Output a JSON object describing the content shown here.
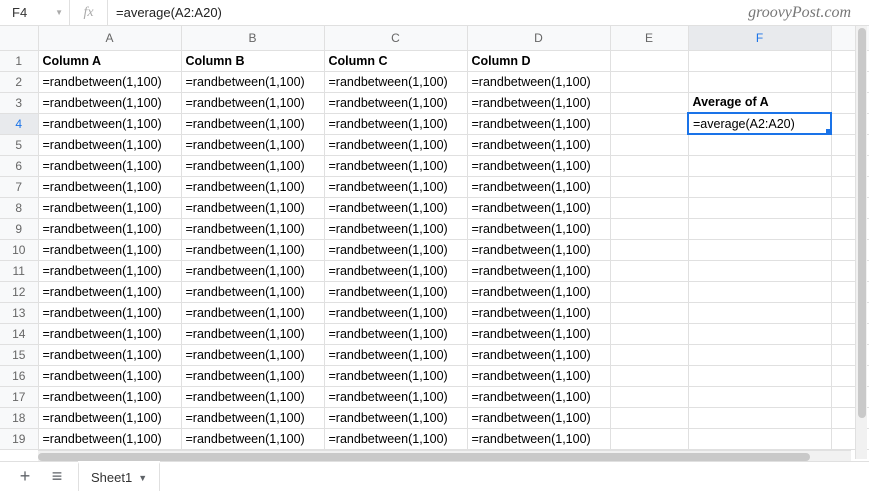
{
  "watermark": "groovyPost.com",
  "namebox": "F4",
  "fx_label": "fx",
  "formula": "=average(A2:A20)",
  "columns": [
    "A",
    "B",
    "C",
    "D",
    "E",
    "F"
  ],
  "active_col": "F",
  "active_row": 4,
  "selected_cell": "F4",
  "tab": {
    "plus": "+",
    "menu": "≡",
    "name": "Sheet1",
    "dd": "▼"
  },
  "rows": [
    {
      "n": 1,
      "cells": {
        "A": "Column A",
        "B": "Column B",
        "C": "Column C",
        "D": "Column D",
        "E": "",
        "F": ""
      },
      "bold": [
        "A",
        "B",
        "C",
        "D"
      ]
    },
    {
      "n": 2,
      "cells": {
        "A": "=randbetween(1,100)",
        "B": "=randbetween(1,100)",
        "C": "=randbetween(1,100)",
        "D": "=randbetween(1,100)",
        "E": "",
        "F": ""
      }
    },
    {
      "n": 3,
      "cells": {
        "A": "=randbetween(1,100)",
        "B": "=randbetween(1,100)",
        "C": "=randbetween(1,100)",
        "D": "=randbetween(1,100)",
        "E": "",
        "F": "Average of A"
      },
      "bold": [
        "F"
      ]
    },
    {
      "n": 4,
      "cells": {
        "A": "=randbetween(1,100)",
        "B": "=randbetween(1,100)",
        "C": "=randbetween(1,100)",
        "D": "=randbetween(1,100)",
        "E": "",
        "F": "=average(A2:A20)"
      }
    },
    {
      "n": 5,
      "cells": {
        "A": "=randbetween(1,100)",
        "B": "=randbetween(1,100)",
        "C": "=randbetween(1,100)",
        "D": "=randbetween(1,100)",
        "E": "",
        "F": ""
      }
    },
    {
      "n": 6,
      "cells": {
        "A": "=randbetween(1,100)",
        "B": "=randbetween(1,100)",
        "C": "=randbetween(1,100)",
        "D": "=randbetween(1,100)",
        "E": "",
        "F": ""
      }
    },
    {
      "n": 7,
      "cells": {
        "A": "=randbetween(1,100)",
        "B": "=randbetween(1,100)",
        "C": "=randbetween(1,100)",
        "D": "=randbetween(1,100)",
        "E": "",
        "F": ""
      }
    },
    {
      "n": 8,
      "cells": {
        "A": "=randbetween(1,100)",
        "B": "=randbetween(1,100)",
        "C": "=randbetween(1,100)",
        "D": "=randbetween(1,100)",
        "E": "",
        "F": ""
      }
    },
    {
      "n": 9,
      "cells": {
        "A": "=randbetween(1,100)",
        "B": "=randbetween(1,100)",
        "C": "=randbetween(1,100)",
        "D": "=randbetween(1,100)",
        "E": "",
        "F": ""
      }
    },
    {
      "n": 10,
      "cells": {
        "A": "=randbetween(1,100)",
        "B": "=randbetween(1,100)",
        "C": "=randbetween(1,100)",
        "D": "=randbetween(1,100)",
        "E": "",
        "F": ""
      }
    },
    {
      "n": 11,
      "cells": {
        "A": "=randbetween(1,100)",
        "B": "=randbetween(1,100)",
        "C": "=randbetween(1,100)",
        "D": "=randbetween(1,100)",
        "E": "",
        "F": ""
      }
    },
    {
      "n": 12,
      "cells": {
        "A": "=randbetween(1,100)",
        "B": "=randbetween(1,100)",
        "C": "=randbetween(1,100)",
        "D": "=randbetween(1,100)",
        "E": "",
        "F": ""
      }
    },
    {
      "n": 13,
      "cells": {
        "A": "=randbetween(1,100)",
        "B": "=randbetween(1,100)",
        "C": "=randbetween(1,100)",
        "D": "=randbetween(1,100)",
        "E": "",
        "F": ""
      }
    },
    {
      "n": 14,
      "cells": {
        "A": "=randbetween(1,100)",
        "B": "=randbetween(1,100)",
        "C": "=randbetween(1,100)",
        "D": "=randbetween(1,100)",
        "E": "",
        "F": ""
      }
    },
    {
      "n": 15,
      "cells": {
        "A": "=randbetween(1,100)",
        "B": "=randbetween(1,100)",
        "C": "=randbetween(1,100)",
        "D": "=randbetween(1,100)",
        "E": "",
        "F": ""
      }
    },
    {
      "n": 16,
      "cells": {
        "A": "=randbetween(1,100)",
        "B": "=randbetween(1,100)",
        "C": "=randbetween(1,100)",
        "D": "=randbetween(1,100)",
        "E": "",
        "F": ""
      }
    },
    {
      "n": 17,
      "cells": {
        "A": "=randbetween(1,100)",
        "B": "=randbetween(1,100)",
        "C": "=randbetween(1,100)",
        "D": "=randbetween(1,100)",
        "E": "",
        "F": ""
      }
    },
    {
      "n": 18,
      "cells": {
        "A": "=randbetween(1,100)",
        "B": "=randbetween(1,100)",
        "C": "=randbetween(1,100)",
        "D": "=randbetween(1,100)",
        "E": "",
        "F": ""
      }
    },
    {
      "n": 19,
      "cells": {
        "A": "=randbetween(1,100)",
        "B": "=randbetween(1,100)",
        "C": "=randbetween(1,100)",
        "D": "=randbetween(1,100)",
        "E": "",
        "F": ""
      }
    }
  ]
}
